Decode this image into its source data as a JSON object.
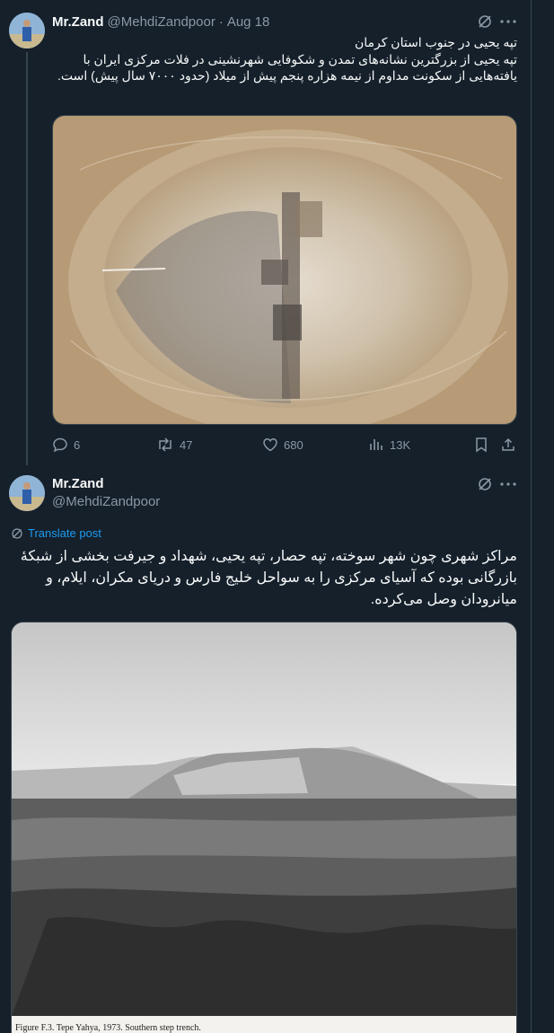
{
  "tweet1": {
    "author": "Mr.Zand",
    "handle": "@MehdiZandpoor",
    "separator": "·",
    "date": "Aug 18",
    "text_line1": "تپه یحیی در جنوب استان کرمان",
    "text_line2": "تپه یحیی از بزرگترین نشانه‌های تمدن و شکوفایی شهرنشینی در فلات مرکزی ایران با یافته‌هایی از سکونت مداوم از نیمه هزاره پنجم پیش از میلاد (حدود ۷۰۰۰ سال پیش) است.",
    "replies": "6",
    "reposts": "47",
    "likes": "680",
    "views": "13K"
  },
  "tweet2": {
    "author": "Mr.Zand",
    "handle": "@MehdiZandpoor",
    "translate_label": "Translate post",
    "text": "مراکز شهری چون شهر سوخته، تپه حصار، تپه یحیی، شهداد و جیرفت بخشی از شبکهٔ بازرگانی بوده که آسیای مرکزی را به سواحل خلیج فارس و دریای مکران، ایلام، و میانرودان وصل می‌کرده.",
    "figure_caption": "Figure F.3. Tepe Yahya, 1973. Southern step trench."
  },
  "colors": {
    "background": "#15202b",
    "text": "#f7f9f9",
    "muted": "#8b98a5",
    "accent": "#1d9bf0",
    "border": "#38444d"
  },
  "icons": [
    "grok-icon",
    "more-icon",
    "reply-icon",
    "repost-icon",
    "like-icon",
    "views-icon",
    "bookmark-icon",
    "share-icon",
    "translate-icon"
  ]
}
